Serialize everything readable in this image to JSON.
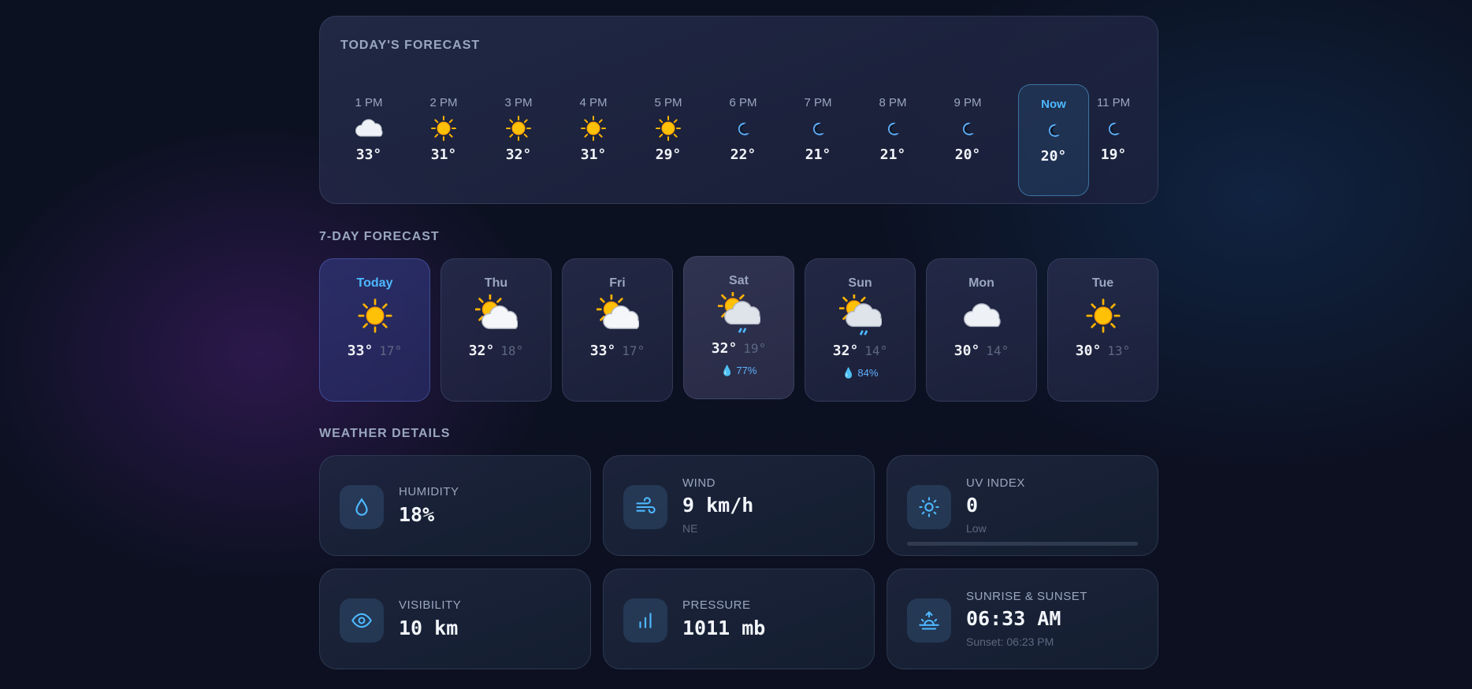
{
  "today": {
    "title": "TODAY'S FORECAST",
    "hours": [
      {
        "time": "1 PM",
        "icon": "cloud-icon",
        "temp": "33°"
      },
      {
        "time": "2 PM",
        "icon": "sun-icon",
        "temp": "31°"
      },
      {
        "time": "3 PM",
        "icon": "sun-icon",
        "temp": "32°"
      },
      {
        "time": "4 PM",
        "icon": "sun-icon",
        "temp": "31°"
      },
      {
        "time": "5 PM",
        "icon": "sun-icon",
        "temp": "29°"
      },
      {
        "time": "6 PM",
        "icon": "moon-icon",
        "temp": "22°"
      },
      {
        "time": "7 PM",
        "icon": "moon-icon",
        "temp": "21°"
      },
      {
        "time": "8 PM",
        "icon": "moon-icon",
        "temp": "21°"
      },
      {
        "time": "9 PM",
        "icon": "moon-icon",
        "temp": "20°"
      },
      {
        "time": "Now",
        "icon": "moon-icon",
        "temp": "20°"
      },
      {
        "time": "11 PM",
        "icon": "moon-icon",
        "temp": "19°"
      }
    ]
  },
  "week": {
    "title": "7-DAY FORECAST",
    "days": [
      {
        "day": "Today",
        "icon": "sun-icon",
        "high": "33°",
        "low": "17°",
        "rain": ""
      },
      {
        "day": "Thu",
        "icon": "partly-cloudy-icon",
        "high": "32°",
        "low": "18°",
        "rain": ""
      },
      {
        "day": "Fri",
        "icon": "partly-cloudy-icon",
        "high": "33°",
        "low": "17°",
        "rain": ""
      },
      {
        "day": "Sat",
        "icon": "rain-cloud-icon",
        "high": "32°",
        "low": "19°",
        "rain": "77%"
      },
      {
        "day": "Sun",
        "icon": "rain-cloud-icon",
        "high": "32°",
        "low": "14°",
        "rain": "84%"
      },
      {
        "day": "Mon",
        "icon": "cloud-icon",
        "high": "30°",
        "low": "14°",
        "rain": ""
      },
      {
        "day": "Tue",
        "icon": "sun-icon",
        "high": "30°",
        "low": "13°",
        "rain": ""
      }
    ]
  },
  "details": {
    "title": "WEATHER DETAILS",
    "humidity": {
      "label": "HUMIDITY",
      "value": "18%"
    },
    "wind": {
      "label": "WIND",
      "value": "9 km/h",
      "sub": "NE"
    },
    "uv": {
      "label": "UV INDEX",
      "value": "0",
      "sub": "Low",
      "level": 0
    },
    "visibility": {
      "label": "VISIBILITY",
      "value": "10 km"
    },
    "pressure": {
      "label": "PRESSURE",
      "value": "1011 mb"
    },
    "sun": {
      "label": "SUNRISE & SUNSET",
      "value": "06:33 AM",
      "sub": "Sunset: 06:23 PM"
    }
  },
  "colors": {
    "accent": "#4db8ff",
    "sun": "#ffc107",
    "rain": "#5fb3ff"
  }
}
